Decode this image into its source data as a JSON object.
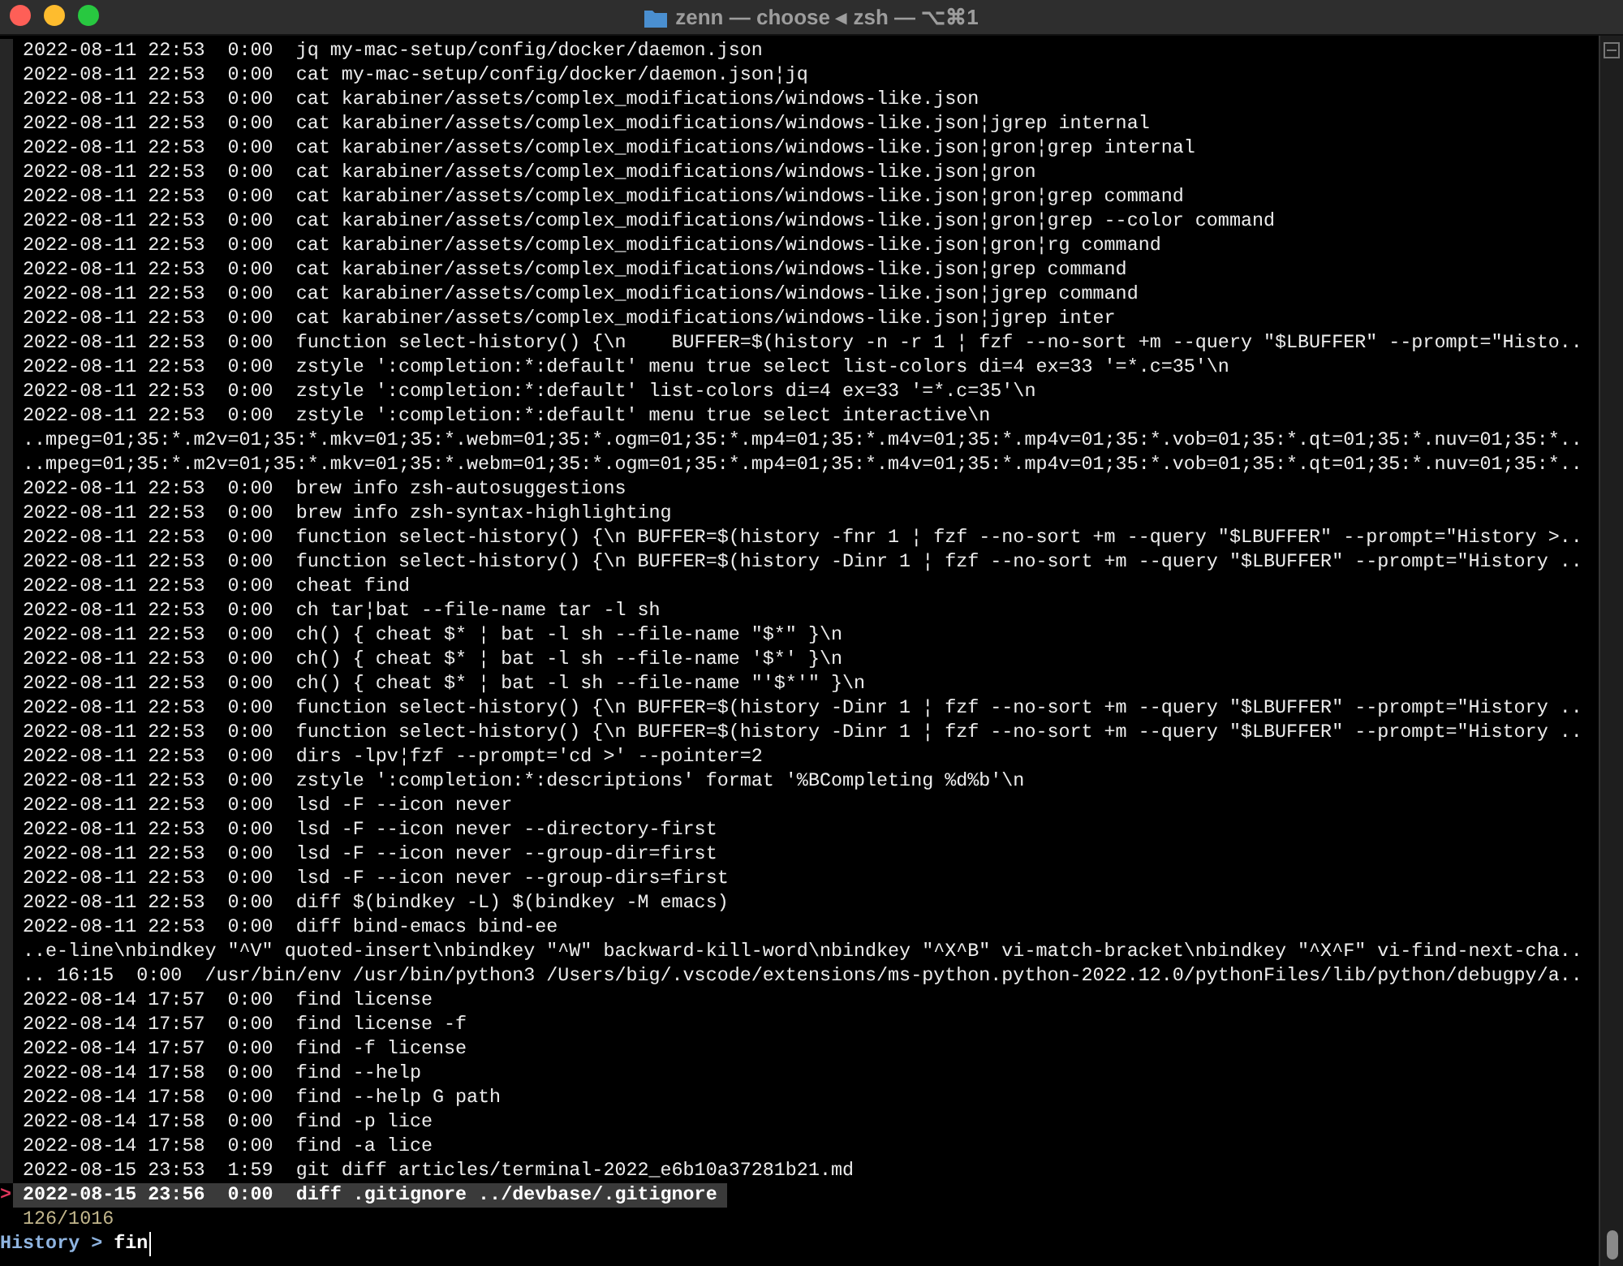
{
  "window": {
    "title": "zenn — choose ◂ zsh — ⌥⌘1"
  },
  "history": {
    "pointer": ">",
    "rows": [
      {
        "text": "2022-08-11 22:53  0:00  jq my-mac-setup/config/docker/daemon.json",
        "selected": false
      },
      {
        "text": "2022-08-11 22:53  0:00  cat my-mac-setup/config/docker/daemon.json¦jq",
        "selected": false
      },
      {
        "text": "2022-08-11 22:53  0:00  cat karabiner/assets/complex_modifications/windows-like.json",
        "selected": false
      },
      {
        "text": "2022-08-11 22:53  0:00  cat karabiner/assets/complex_modifications/windows-like.json¦jgrep internal",
        "selected": false
      },
      {
        "text": "2022-08-11 22:53  0:00  cat karabiner/assets/complex_modifications/windows-like.json¦gron¦grep internal",
        "selected": false
      },
      {
        "text": "2022-08-11 22:53  0:00  cat karabiner/assets/complex_modifications/windows-like.json¦gron",
        "selected": false
      },
      {
        "text": "2022-08-11 22:53  0:00  cat karabiner/assets/complex_modifications/windows-like.json¦gron¦grep command",
        "selected": false
      },
      {
        "text": "2022-08-11 22:53  0:00  cat karabiner/assets/complex_modifications/windows-like.json¦gron¦grep --color command",
        "selected": false
      },
      {
        "text": "2022-08-11 22:53  0:00  cat karabiner/assets/complex_modifications/windows-like.json¦gron¦rg command",
        "selected": false
      },
      {
        "text": "2022-08-11 22:53  0:00  cat karabiner/assets/complex_modifications/windows-like.json¦grep command",
        "selected": false
      },
      {
        "text": "2022-08-11 22:53  0:00  cat karabiner/assets/complex_modifications/windows-like.json¦jgrep command",
        "selected": false
      },
      {
        "text": "2022-08-11 22:53  0:00  cat karabiner/assets/complex_modifications/windows-like.json¦jgrep inter",
        "selected": false
      },
      {
        "text": "2022-08-11 22:53  0:00  function select-history() {\\n    BUFFER=$(history -n -r 1 ¦ fzf --no-sort +m --query \"$LBUFFER\" --prompt=\"Histo..",
        "selected": false
      },
      {
        "text": "2022-08-11 22:53  0:00  zstyle ':completion:*:default' menu true select list-colors di=4 ex=33 '=*.c=35'\\n",
        "selected": false
      },
      {
        "text": "2022-08-11 22:53  0:00  zstyle ':completion:*:default' list-colors di=4 ex=33 '=*.c=35'\\n",
        "selected": false
      },
      {
        "text": "2022-08-11 22:53  0:00  zstyle ':completion:*:default' menu true select interactive\\n",
        "selected": false
      },
      {
        "text": "..mpeg=01;35:*.m2v=01;35:*.mkv=01;35:*.webm=01;35:*.ogm=01;35:*.mp4=01;35:*.m4v=01;35:*.mp4v=01;35:*.vob=01;35:*.qt=01;35:*.nuv=01;35:*..",
        "selected": false
      },
      {
        "text": "..mpeg=01;35:*.m2v=01;35:*.mkv=01;35:*.webm=01;35:*.ogm=01;35:*.mp4=01;35:*.m4v=01;35:*.mp4v=01;35:*.vob=01;35:*.qt=01;35:*.nuv=01;35:*..",
        "selected": false
      },
      {
        "text": "2022-08-11 22:53  0:00  brew info zsh-autosuggestions",
        "selected": false
      },
      {
        "text": "2022-08-11 22:53  0:00  brew info zsh-syntax-highlighting",
        "selected": false
      },
      {
        "text": "2022-08-11 22:53  0:00  function select-history() {\\n BUFFER=$(history -fnr 1 ¦ fzf --no-sort +m --query \"$LBUFFER\" --prompt=\"History >..",
        "selected": false
      },
      {
        "text": "2022-08-11 22:53  0:00  function select-history() {\\n BUFFER=$(history -Dinr 1 ¦ fzf --no-sort +m --query \"$LBUFFER\" --prompt=\"History ..",
        "selected": false
      },
      {
        "text": "2022-08-11 22:53  0:00  cheat find",
        "selected": false
      },
      {
        "text": "2022-08-11 22:53  0:00  ch tar¦bat --file-name tar -l sh",
        "selected": false
      },
      {
        "text": "2022-08-11 22:53  0:00  ch() { cheat $* ¦ bat -l sh --file-name \"$*\" }\\n",
        "selected": false
      },
      {
        "text": "2022-08-11 22:53  0:00  ch() { cheat $* ¦ bat -l sh --file-name '$*' }\\n",
        "selected": false
      },
      {
        "text": "2022-08-11 22:53  0:00  ch() { cheat $* ¦ bat -l sh --file-name \"'$*'\" }\\n",
        "selected": false
      },
      {
        "text": "2022-08-11 22:53  0:00  function select-history() {\\n BUFFER=$(history -Dinr 1 ¦ fzf --no-sort +m --query \"$LBUFFER\" --prompt=\"History ..",
        "selected": false
      },
      {
        "text": "2022-08-11 22:53  0:00  function select-history() {\\n BUFFER=$(history -Dinr 1 ¦ fzf --no-sort +m --query \"$LBUFFER\" --prompt=\"History ..",
        "selected": false
      },
      {
        "text": "2022-08-11 22:53  0:00  dirs -lpv¦fzf --prompt='cd >' --pointer=2",
        "selected": false
      },
      {
        "text": "2022-08-11 22:53  0:00  zstyle ':completion:*:descriptions' format '%BCompleting %d%b'\\n",
        "selected": false
      },
      {
        "text": "2022-08-11 22:53  0:00  lsd -F --icon never",
        "selected": false
      },
      {
        "text": "2022-08-11 22:53  0:00  lsd -F --icon never --directory-first",
        "selected": false
      },
      {
        "text": "2022-08-11 22:53  0:00  lsd -F --icon never --group-dir=first",
        "selected": false
      },
      {
        "text": "2022-08-11 22:53  0:00  lsd -F --icon never --group-dirs=first",
        "selected": false
      },
      {
        "text": "2022-08-11 22:53  0:00  diff $(bindkey -L) $(bindkey -M emacs)",
        "selected": false
      },
      {
        "text": "2022-08-11 22:53  0:00  diff bind-emacs bind-ee",
        "selected": false
      },
      {
        "text": "..e-line\\nbindkey \"^V\" quoted-insert\\nbindkey \"^W\" backward-kill-word\\nbindkey \"^X^B\" vi-match-bracket\\nbindkey \"^X^F\" vi-find-next-cha..",
        "selected": false
      },
      {
        "text": ".. 16:15  0:00  /usr/bin/env /usr/bin/python3 /Users/big/.vscode/extensions/ms-python.python-2022.12.0/pythonFiles/lib/python/debugpy/a..",
        "selected": false
      },
      {
        "text": "2022-08-14 17:57  0:00  find license",
        "selected": false
      },
      {
        "text": "2022-08-14 17:57  0:00  find license -f",
        "selected": false
      },
      {
        "text": "2022-08-14 17:57  0:00  find -f license",
        "selected": false
      },
      {
        "text": "2022-08-14 17:58  0:00  find --help",
        "selected": false
      },
      {
        "text": "2022-08-14 17:58  0:00  find --help G path",
        "selected": false
      },
      {
        "text": "2022-08-14 17:58  0:00  find -p lice",
        "selected": false
      },
      {
        "text": "2022-08-14 17:58  0:00  find -a lice",
        "selected": false
      },
      {
        "text": "2022-08-15 23:53  1:59  git diff articles/terminal-2022_e6b10a37281b21.md",
        "selected": false
      },
      {
        "text": "2022-08-15 23:56  0:00  diff .gitignore ../devbase/.gitignore",
        "selected": true
      }
    ]
  },
  "counter": "126/1016",
  "prompt": {
    "label": "History >",
    "query": "fin"
  }
}
